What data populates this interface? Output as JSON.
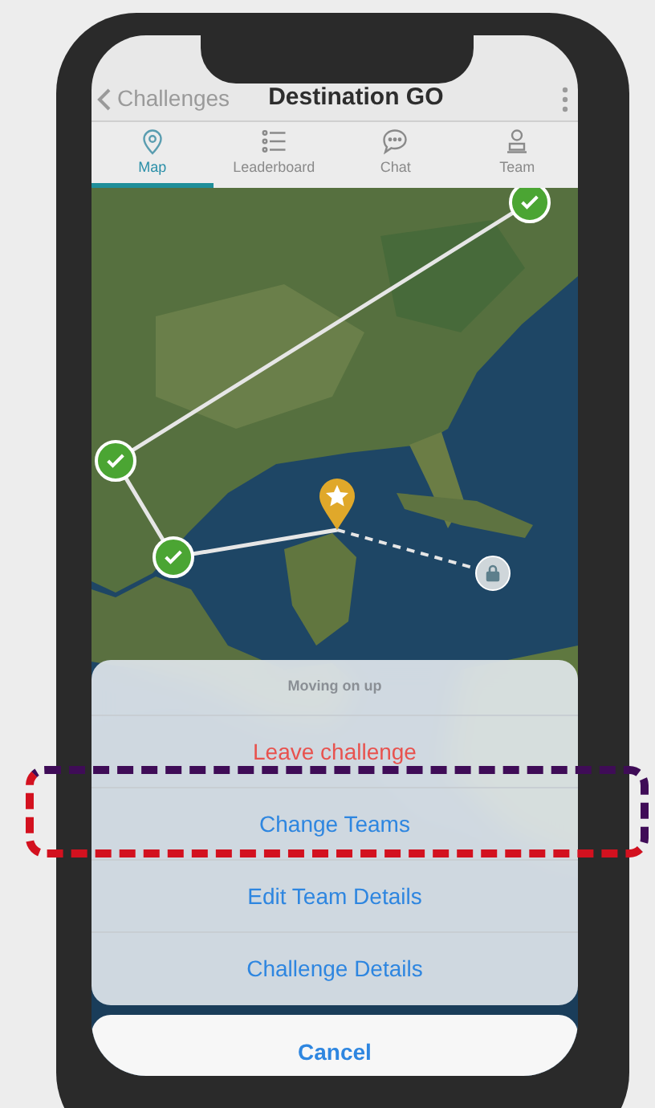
{
  "nav": {
    "back_label": "Challenges",
    "title": "Destination GO"
  },
  "tabs": [
    {
      "label": "Map",
      "selected": true
    },
    {
      "label": "Leaderboard",
      "selected": false
    },
    {
      "label": "Chat",
      "selected": false
    },
    {
      "label": "Team",
      "selected": false
    }
  ],
  "action_sheet": {
    "title": "Moving on up",
    "actions": [
      {
        "label": "Leave challenge",
        "kind": "destructive"
      },
      {
        "label": "Change Teams",
        "kind": "default"
      },
      {
        "label": "Edit Team Details",
        "kind": "default"
      },
      {
        "label": "Challenge Details",
        "kind": "default"
      }
    ],
    "cancel": "Cancel"
  }
}
